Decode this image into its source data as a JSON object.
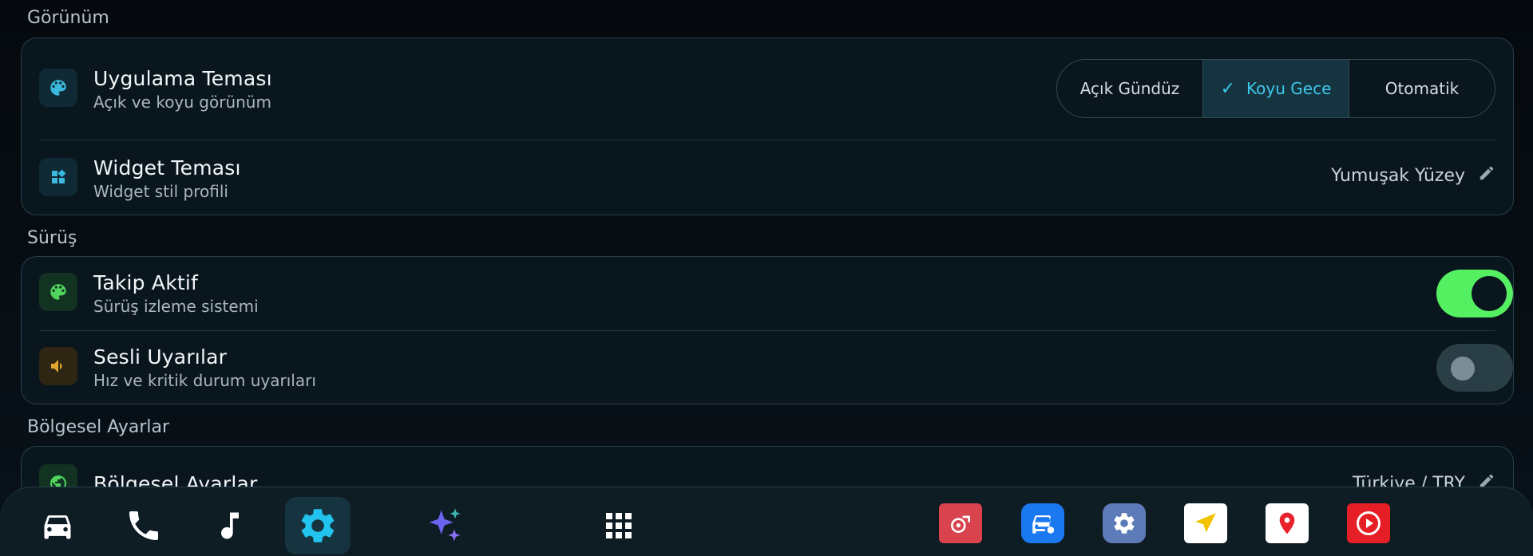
{
  "sections": {
    "appearance": "Görünüm",
    "driving": "Sürüş",
    "regional": "Bölgesel Ayarlar"
  },
  "appearance": {
    "app_theme": {
      "title": "Uygulama Teması",
      "subtitle": "Açık ve koyu görünüm",
      "icon": "palette-icon",
      "options": [
        "Açık Gündüz",
        "Koyu Gece",
        "Otomatik"
      ],
      "selected": "Koyu Gece"
    },
    "widget_theme": {
      "title": "Widget Teması",
      "subtitle": "Widget stil profili",
      "icon": "widgets-icon",
      "value": "Yumuşak Yüzey"
    }
  },
  "driving": {
    "tracking": {
      "title": "Takip Aktif",
      "subtitle": "Sürüş izleme sistemi",
      "icon": "palette-icon",
      "enabled": true
    },
    "audio_alerts": {
      "title": "Sesli Uyarılar",
      "subtitle": "Hız ve kritik durum uyarıları",
      "icon": "speaker-icon",
      "enabled": false
    }
  },
  "regional": {
    "settings": {
      "title": "Bölgesel Ayarlar",
      "icon": "globe-icon",
      "value": "Türkiye / TRY"
    }
  },
  "dock": {
    "items": [
      "car-icon",
      "phone-icon",
      "music-note-icon",
      "settings-gear-icon",
      "sparkle-ai-icon",
      "app-grid-icon"
    ],
    "active": "settings-gear-icon",
    "apps": [
      "turbo-app-icon",
      "car-service-app-icon",
      "system-settings-app-icon",
      "navigation-arrow-app-icon",
      "maps-pin-app-icon",
      "video-play-app-icon"
    ]
  },
  "colors": {
    "accent": "#3fc7ec",
    "toggle_on": "#55f062",
    "background": "#040b10",
    "card": "#0a161e"
  }
}
